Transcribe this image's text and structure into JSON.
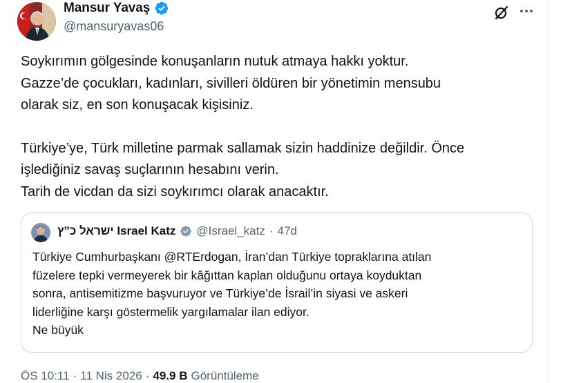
{
  "author": {
    "name": "Mansur Yavaş",
    "handle": "@mansuryavas06"
  },
  "tweet": {
    "paragraphs": [
      [
        "Soykırımın gölgesinde konuşanların nutuk atmaya hakkı yoktur.",
        "Gazze’de çocukları, kadınları, sivilleri öldüren bir yönetimin mensubu",
        "olarak siz, en son konuşacak kişisiniz."
      ],
      [
        "Türkiye’ye, Türk milletine parmak sallamak sizin haddinize değildir. Önce",
        "işlediğiniz savaş suçlarının hesabını verin.",
        "Tarih de vicdan da sizi soykırımcı olarak anacaktır."
      ]
    ]
  },
  "quote": {
    "name": "ישראל כ”ץ Israel Katz",
    "handle": "@Israel_katz",
    "separator": "·",
    "time": "47d",
    "lines": [
      "Türkiye Cumhurbaşkanı @RTErdogan, İran’dan Türkiye topraklarına atılan",
      "füzelere tepki vermeyerek bir kâğıttan kaplan olduğunu ortaya koyduktan",
      "sonra, antisemitizme başvuruyor ve Türkiye’de İsrail’in siyasi ve askeri",
      "liderliğine karşı göstermelik yargılamalar ilan ediyor.",
      "Ne büyük"
    ]
  },
  "meta": {
    "time": "ÖS 10:11",
    "sep1": "·",
    "date": "11 Nis 2026",
    "sep2": "·",
    "views_count": "49.9 B",
    "views_label": "Görüntüleme"
  },
  "colors": {
    "text": "#0f1419",
    "secondary": "#536471",
    "verified": "#1d9bf0",
    "border": "#cfd9de"
  },
  "icons": [
    "verified-badge-icon",
    "grok-icon",
    "more-icon"
  ]
}
